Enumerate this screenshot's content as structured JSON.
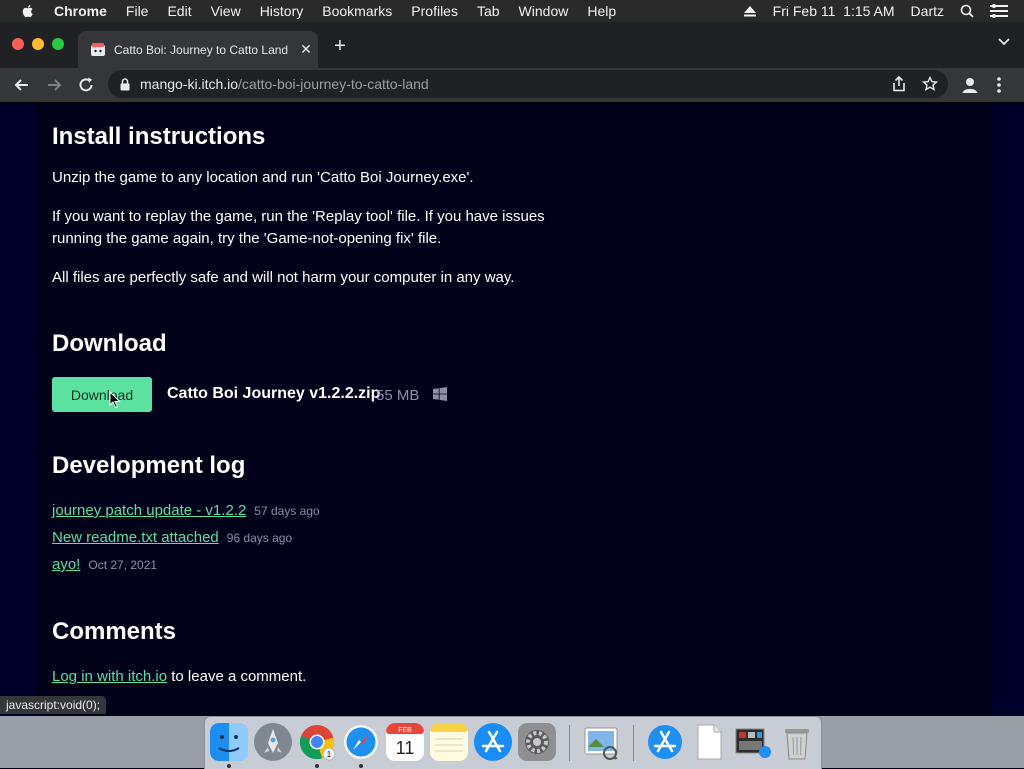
{
  "menubar": {
    "app_name": "Chrome",
    "items": [
      "File",
      "Edit",
      "View",
      "History",
      "Bookmarks",
      "Profiles",
      "Tab",
      "Window",
      "Help"
    ],
    "datetime": "Fri Feb 11  1:15 AM",
    "user": "Dartz"
  },
  "browser": {
    "tab_title": "Catto Boi: Journey to Catto Land",
    "url_host": "mango-ki.itch.io",
    "url_path": "/catto-boi-journey-to-catto-land"
  },
  "page": {
    "install": {
      "heading": "Install instructions",
      "p1": "Unzip the game to any location and run 'Catto Boi Journey.exe'.",
      "p2": "If you want to replay the game, run the 'Replay tool' file. If you have issues running the game again, try the 'Game-not-opening fix' file.",
      "p3": "All files are perfectly safe and will not harm your computer in any way."
    },
    "download": {
      "heading": "Download",
      "button_label": "Download",
      "file_name": "Catto Boi Journey v1.2.2.zip",
      "file_size": "55 MB",
      "platform_icon": "windows-icon"
    },
    "devlog": {
      "heading": "Development log",
      "entries": [
        {
          "title": "journey patch update - v1.2.2",
          "date": "57 days ago"
        },
        {
          "title": "New readme.txt attached",
          "date": "96 days ago"
        },
        {
          "title": "ayo!",
          "date": "Oct 27, 2021"
        }
      ]
    },
    "comments": {
      "heading": "Comments",
      "login_link": "Log in with itch.io",
      "login_suffix": " to leave a comment."
    }
  },
  "status_bar": "javascript:void(0);",
  "dock": {
    "apps": [
      "finder-icon",
      "launchpad-icon",
      "chrome-icon",
      "safari-icon",
      "calendar-icon",
      "notes-icon",
      "app-store-icon",
      "system-preferences-icon",
      "preview-icon",
      "applications-folder-icon",
      "document-icon",
      "downloads-stack-icon",
      "trash-icon"
    ],
    "calendar_month": "FEB",
    "calendar_day": "11",
    "chrome_badge": "1"
  },
  "colors": {
    "accent": "#5be1a0",
    "page_bg": "#010119",
    "text": "#ffffff",
    "muted": "#8e8ea8"
  }
}
